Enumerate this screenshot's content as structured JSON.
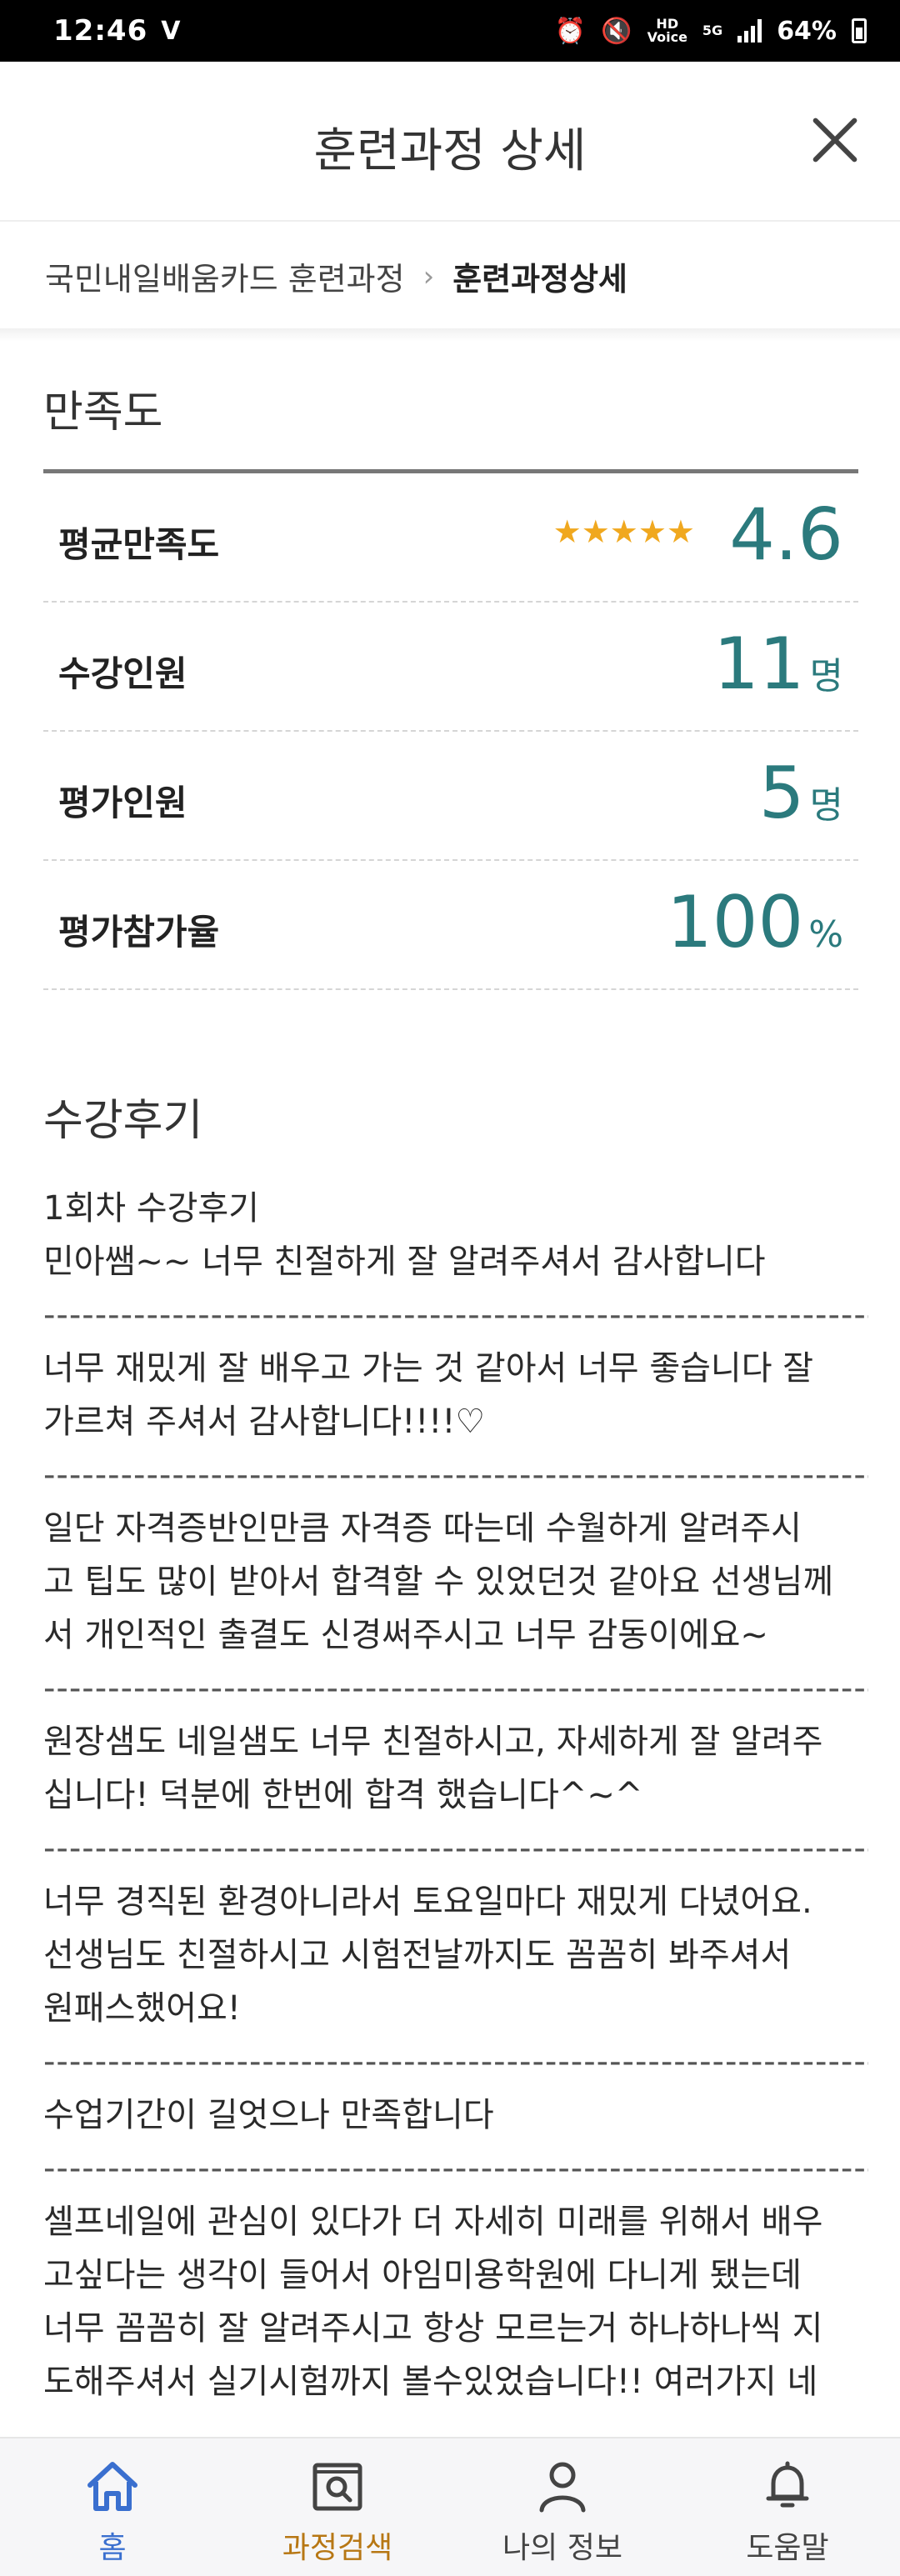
{
  "status_bar": {
    "time": "12:46",
    "left_icon": "V",
    "hd_label": "HD",
    "voice_label": "Voice",
    "network": "5G",
    "battery": "64%"
  },
  "header": {
    "title": "훈련과정 상세",
    "close_icon": "close-icon"
  },
  "breadcrumb": {
    "parent": "국민내일배움카드 훈련과정",
    "separator": "›",
    "current": "훈련과정상세"
  },
  "satisfaction": {
    "title": "만족도",
    "rows": [
      {
        "label": "평균만족도",
        "value": "4.6",
        "unit": "",
        "stars": "★★★★★"
      },
      {
        "label": "수강인원",
        "value": "11",
        "unit": "명"
      },
      {
        "label": "평가인원",
        "value": "5",
        "unit": "명"
      },
      {
        "label": "평가참가율",
        "value": "100",
        "unit": "%"
      }
    ]
  },
  "reviews": {
    "title": "수강후기",
    "divider": "-------------------------------------------------------------------------------------------------------",
    "items": [
      "1회차 수강후기\n민아쌤~~ 너무 친절하게 잘 알려주셔서 감사합니다",
      "너무 재밌게 잘 배우고 가는 것 같아서 너무 좋습니다 잘\n가르쳐 주셔서 감사합니다!!!!♡",
      "일단 자격증반인만큼 자격증 따는데 수월하게 알려주시\n고 팁도 많이 받아서 합격할 수 있었던것 같아요 선생님께\n서 개인적인 출결도 신경써주시고 너무 감동이에요~",
      "원장샘도 네일샘도 너무 친절하시고, 자세하게 잘 알려주\n십니다! 덕분에 한번에 합격 했습니다^~^",
      "너무 경직된 환경아니라서 토요일마다 재밌게 다녔어요.\n선생님도 친절하시고 시험전날까지도 꼼꼼히 봐주셔서\n원패스했어요!",
      "수업기간이 길엇으나 만족합니다",
      "셀프네일에 관심이 있다가 더 자세히 미래를 위해서 배우\n고싶다는 생각이 들어서 아임미용학원에 다니게 됐는데\n너무 꼼꼼히 잘 알려주시고 항상 모르는거 하나하나씩 지\n도해주셔서 실기시험까지 볼수있었습니다!! 여러가지 네"
    ]
  },
  "bottom_nav": {
    "items": [
      {
        "label": "홈",
        "icon": "home-icon"
      },
      {
        "label": "과정검색",
        "icon": "course-search-icon"
      },
      {
        "label": "나의 정보",
        "icon": "person-icon"
      },
      {
        "label": "도움말",
        "icon": "bell-icon"
      }
    ]
  },
  "colors": {
    "value_teal": "#2b7a7d",
    "star_gold": "#f0a81f",
    "nav_active_blue": "#3a6fcf",
    "nav_search_orange": "#b77714"
  }
}
